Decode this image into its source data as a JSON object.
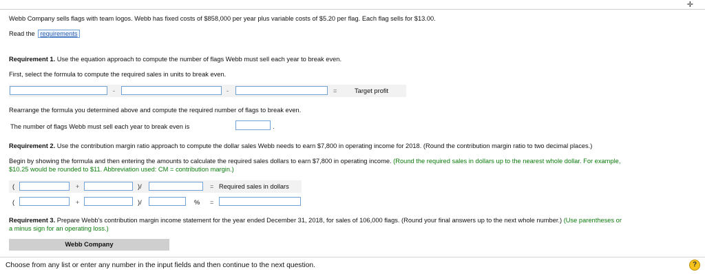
{
  "intro": "Webb Company sells flags with team logos. Webb has fixed costs of $858,000 per year plus variable costs of $5.20 per flag. Each flag sells for $13.00.",
  "read_the": "Read the",
  "requirements_link": "requirements",
  "req1": {
    "label": "Requirement 1.",
    "text": " Use the equation approach to compute the number of flags Webb must sell each year to break even.",
    "first_select": "First, select the formula to compute the required sales in units to break even.",
    "op1": "-",
    "op2": "-",
    "equals": "=",
    "target_profit": "Target profit",
    "rearrange": "Rearrange the formula you determined above and compute the required number of flags to break even.",
    "breakeven_label": "The number of flags Webb must sell each year to break even is",
    "period": "."
  },
  "req2": {
    "label": "Requirement 2.",
    "text": " Use the contribution margin ratio approach to compute the dollar sales Webb needs to earn $7,800 in operating income for 2018. (Round the contribution margin ratio to two decimal places.)",
    "begin_line1": "Begin by showing the formula and then entering the amounts to calculate the required sales dollars to earn $7,800 in operating income.",
    "green_line1": " (Round the required sales in dollars up to the nearest whole dollar. For example,",
    "green_line2": "$10.25 would be rounded to $11. Abbreviation used: CM = contribution margin.)",
    "open_paren": "(",
    "plus": "+",
    "close_div": ")/",
    "equals": "=",
    "required_sales_label": "Required sales in dollars",
    "percent": "%"
  },
  "req3": {
    "label": "Requirement 3.",
    "text": " Prepare Webb's contribution margin income statement for the year ended December 31, 2018, for sales of 106,000 flags. (Round your final answers up to the next whole number.)",
    "green_line1": " (Use parentheses or",
    "green_line2": "a minus sign for an operating loss.)",
    "company_header": "Webb Company"
  },
  "footer": {
    "instruction": "Choose from any list or enter any number in the input fields and then continue to the next question.",
    "help_icon": "?"
  },
  "corner_icon": "expand-icon",
  "colors": {
    "input_border": "#6fa0d8",
    "green_note": "#0a7a0a",
    "help_icon": "#f5c31c"
  }
}
